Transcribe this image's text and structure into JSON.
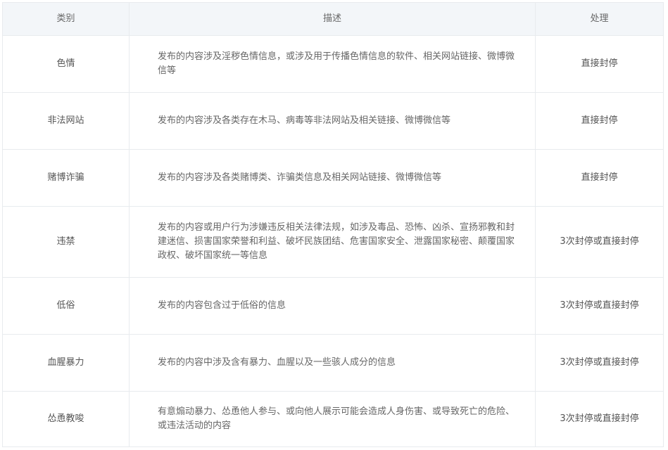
{
  "header": {
    "category": "类别",
    "description": "描述",
    "action": "处理"
  },
  "rows": [
    {
      "category": "色情",
      "description": "发布的内容涉及淫秽色情信息，或涉及用于传播色情信息的软件、相关网站链接、微博微信等",
      "action": "直接封停"
    },
    {
      "category": "非法网站",
      "description": "发布的内容涉及各类存在木马、病毒等非法网站及相关链接、微博微信等",
      "action": "直接封停"
    },
    {
      "category": "赌博诈骗",
      "description": "发布的内容涉及各类赌博类、诈骗类信息及相关网站链接、微博微信等",
      "action": "直接封停"
    },
    {
      "category": "违禁",
      "description": "发布的内容或用户行为涉嫌违反相关法律法规，如涉及毒品、恐怖、凶杀、宣扬邪教和封建迷信、损害国家荣誉和利益、破坏民族团结、危害国家安全、泄露国家秘密、颠覆国家政权、破坏国家统一等信息",
      "action": "3次封停或直接封停"
    },
    {
      "category": "低俗",
      "description": "发布的内容包含过于低俗的信息",
      "action": "3次封停或直接封停"
    },
    {
      "category": "血腥暴力",
      "description": "发布的内容中涉及含有暴力、血腥以及一些骇人成分的信息",
      "action": "3次封停或直接封停"
    },
    {
      "category": "怂恿教唆",
      "description": "有意煽动暴力、怂恿他人参与、或向他人展示可能会造成人身伤害、或导致死亡的危险、或违法活动的内容",
      "action": "3次封停或直接封停"
    }
  ]
}
